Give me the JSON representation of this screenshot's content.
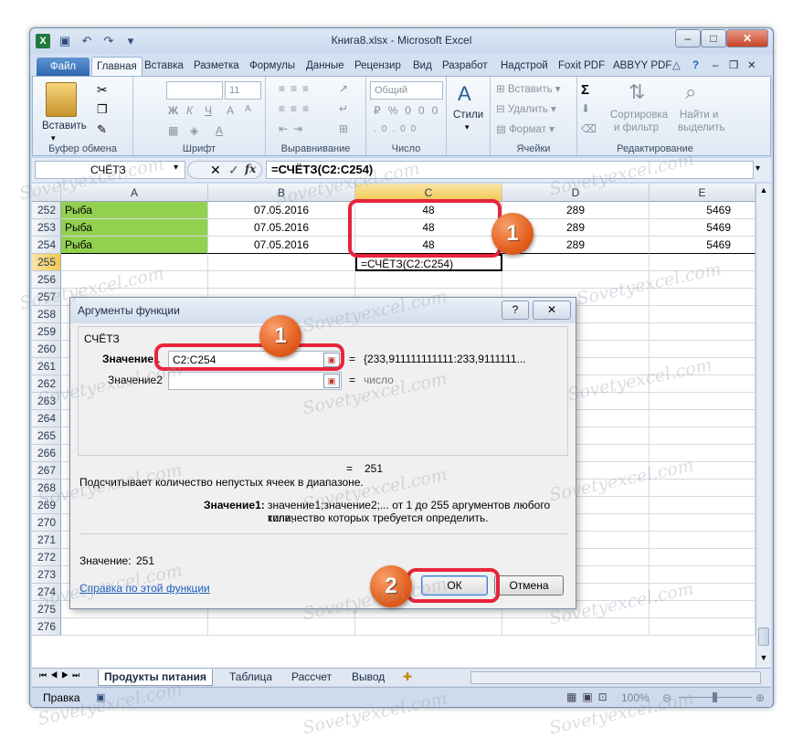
{
  "window": {
    "title": "Книга8.xlsx - Microsoft Excel",
    "min": "–",
    "max": "□",
    "close": "✕"
  },
  "tabs": [
    "Файл",
    "Главная",
    "Вставка",
    "Разметка",
    "Формулы",
    "Данные",
    "Рецензир",
    "Вид",
    "Разработ",
    "Надстрой",
    "Foxit PDF",
    "ABBYY PDF"
  ],
  "ribbon": {
    "clipboard": {
      "paste": "Вставить",
      "label": "Буфер обмена"
    },
    "font": {
      "size": "11",
      "label": "Шрифт"
    },
    "align": {
      "label": "Выравнивание"
    },
    "number": {
      "format": "Общий",
      "label": "Число"
    },
    "styles": {
      "label": "Стили"
    },
    "cells": {
      "insert": "Вставить",
      "delete": "Удалить",
      "format": "Формат",
      "label": "Ячейки"
    },
    "editing": {
      "sort": "Сортировка",
      "sort2": "и фильтр",
      "find": "Найти и",
      "find2": "выделить",
      "label": "Редактирование"
    }
  },
  "formula_bar": {
    "name": "СЧЁТЗ",
    "formula": "=СЧЁТЗ(C2:C254)"
  },
  "columns": [
    "A",
    "B",
    "C",
    "D",
    "E"
  ],
  "rows": [
    {
      "n": "252",
      "a": "Рыба",
      "b": "07.05.2016",
      "c": "48",
      "d": "289",
      "e": "5469"
    },
    {
      "n": "253",
      "a": "Рыба",
      "b": "07.05.2016",
      "c": "48",
      "d": "289",
      "e": "5469"
    },
    {
      "n": "254",
      "a": "Рыба",
      "b": "07.05.2016",
      "c": "48",
      "d": "289",
      "e": "5469"
    },
    {
      "n": "255",
      "a": "",
      "b": "",
      "c": "=СЧЁТЗ(C2:C254)",
      "d": "",
      "e": ""
    }
  ],
  "empty_rows": [
    "256",
    "257",
    "258",
    "259",
    "260",
    "261",
    "262",
    "263",
    "264",
    "265",
    "266",
    "267",
    "268",
    "269",
    "270",
    "271",
    "272",
    "273",
    "274",
    "275",
    "276"
  ],
  "sheet_tabs": [
    "Продукты питания",
    "Таблица",
    "Рассчет",
    "Вывод"
  ],
  "status": {
    "ready": "Правка",
    "zoom": "100%"
  },
  "dialog": {
    "title": "Аргументы функции",
    "help_q": "?",
    "close": "✕",
    "func": "СЧЁТЗ",
    "arg1_label": "Значение1",
    "arg1_value": "C2:C254",
    "arg1_result": "{233,911111111111:233,9111111...",
    "arg2_label": "Значение2",
    "arg2_result": "число",
    "eq": "=",
    "total": "251",
    "description": "Подсчитывает количество непустых ячеек в диапазоне.",
    "arg_desc_label": "Значение1:",
    "arg_desc": "значение1;значение2;... от 1 до 255 аргументов любого типа,",
    "arg_desc2": "количество которых требуется определить.",
    "value_label": "Значение:",
    "value": "251",
    "help_link": "Справка по этой функции",
    "ok": "ОК",
    "cancel": "Отмена"
  },
  "badges": {
    "one": "1",
    "two": "2"
  },
  "watermark": "Sovetyexcel.com"
}
